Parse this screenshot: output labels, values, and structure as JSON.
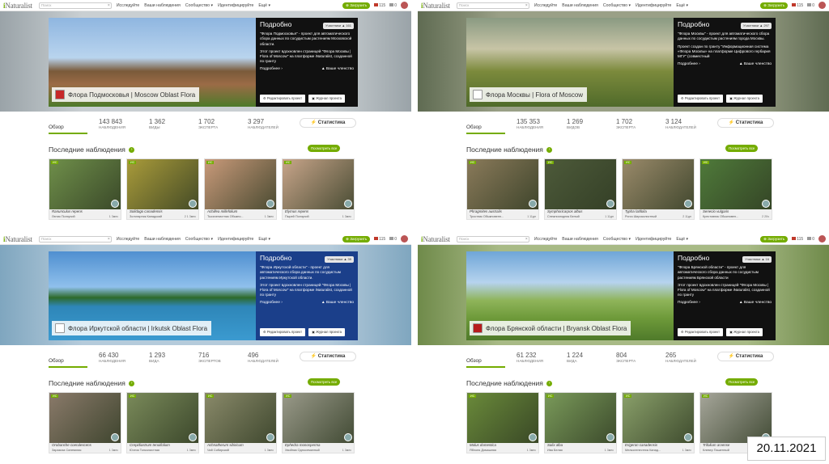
{
  "topbar": {
    "logo_prefix": "i",
    "logo_text": "Naturalist",
    "search_placeholder": "Поиск",
    "nav": [
      "Исследуйте",
      "Ваши наблюдения",
      "Сообщество ▾",
      "Идентифицируйте",
      "Ещё ▾"
    ],
    "upload": "⊕ Загрузить",
    "messages_count": "115",
    "notifications_count": "0"
  },
  "labels": {
    "about": "Подробно",
    "members": "Участники",
    "your_membership": "▲ Ваше членство",
    "details_link": "Подробнее ›",
    "edit_project": "⚙ Редактировать проект",
    "project_journal": "▣ Журнал проекта",
    "overview_tab": "Обзор",
    "stats_button": "Статистика",
    "recent_heading": "Последние наблюдения",
    "view_all": "Посмотреть все",
    "research_grade": "ИС"
  },
  "date": "20.11.2021",
  "panels": [
    {
      "title": "Флора Подмосковья | Moscow Oblast Flora",
      "members": "161",
      "desc1": "\"Флора Подмосковья\" - проект для автоматического сбора данных по сосудистым растениям Московской области.",
      "desc2": "Этот проект вдохновлен страницей \"Флора Москвы | Flora of Moscow\" на платформе iNaturalist, созданной по гранту",
      "stats": {
        "observations": "143 843",
        "observations_label": "НАБЛЮДЕНИЯ",
        "species": "1 362",
        "species_label": "ВИДЫ",
        "identifiers": "1 702",
        "identifiers_label": "ЭКСПЕРТА",
        "observers": "3 297",
        "observers_label": "НАБЛЮДАТЕЛЕЙ"
      },
      "cards": [
        {
          "sci": "Ranunculus repens",
          "common": "Лютик Ползучий",
          "meta": "1 3мес"
        },
        {
          "sci": "Solidago canadensis",
          "common": "Золотарник Канадский",
          "meta": "2 1 3мес"
        },
        {
          "sci": "Achillea millefolium",
          "common": "Тысячелистник Обыкно...",
          "meta": "1 3мес"
        },
        {
          "sci": "Elymus repens",
          "common": "Пырей Ползучий",
          "meta": "1 3мес"
        }
      ]
    },
    {
      "title": "Флора Москвы | Flora of Moscow",
      "members": "297",
      "desc1": "\"Флора Москвы\" - проект для автоматического сбора данных по сосудистым растениям города Москвы.",
      "desc2": "Проект создан по гранту \"Информационная система «Флора Москвы» на платформе Цифрового гербария МГУ\" (совместный",
      "stats": {
        "observations": "135 353",
        "observations_label": "НАБЛЮДЕНИЯ",
        "species": "1 269",
        "species_label": "ВИДОВ",
        "identifiers": "1 702",
        "identifiers_label": "ЭКСПЕРТА",
        "observers": "3 124",
        "observers_label": "НАБЛЮДАТЕЛЕЙ"
      },
      "cards": [
        {
          "sci": "Phragmites australis",
          "common": "Тростник Обыкновенн...",
          "meta": "1 11дн"
        },
        {
          "sci": "Symphoricarpos albus",
          "common": "Снежноягодник Белый",
          "meta": "1 11дн"
        },
        {
          "sci": "Typha latifolia",
          "common": "Рогоз Широколистный",
          "meta": "2 11дн"
        },
        {
          "sci": "Senecio vulgaris",
          "common": "Крестовник Обыкновен...",
          "meta": "2 20ч"
        }
      ]
    },
    {
      "title": "Флора Иркутской области | Irkutsk Oblast Flora",
      "members": "39",
      "desc1": "\"Флора Иркутской области\" - проект для автоматического сбора данных по сосудистым растениям Иркутской области.",
      "desc2": "Этот проект вдохновлен страницей \"Флора Москвы | Flora of Moscow\" на платформе iNaturalist, созданной по гранту",
      "stats": {
        "observations": "66 430",
        "observations_label": "НАБЛЮДЕНИЯ",
        "species": "1 293",
        "species_label": "ВИДА",
        "identifiers": "716",
        "identifiers_label": "ЭКСПЕРТОВ",
        "observers": "496",
        "observers_label": "НАБЛЮДАТЕЛЕЙ"
      },
      "cards": [
        {
          "sci": "Orobanche coerulescens",
          "common": "Заразиха Синеватая",
          "meta": "1 3мес"
        },
        {
          "sci": "Crepidiastrum tenuifolium",
          "common": "Ючтия Тонколистная",
          "meta": "1 3мес"
        },
        {
          "sci": "Achnatherum sibiricum",
          "common": "Чий Сибирский",
          "meta": "1 3мес"
        },
        {
          "sci": "Ephedra monosperma",
          "common": "Хвойник Односемянный",
          "meta": "1 3мес"
        }
      ]
    },
    {
      "title": "Флора Брянской области | Bryansk Oblast Flora",
      "members": "16",
      "desc1": "\"Флора Брянской области\" - проект для автоматического сбора данных по сосудистым растениям Брянской области",
      "desc2": "Этот проект вдохновлен страницей \"Флора Москвы | Flora of Moscow\" на платформе iNaturalist, созданной по гранту",
      "stats": {
        "observations": "61 232",
        "observations_label": "НАБЛЮДЕНИЯ",
        "species": "1 224",
        "species_label": "ВИДА",
        "identifiers": "804",
        "identifiers_label": "ЭКСПЕРТА",
        "observers": "265",
        "observers_label": "НАБЛЮДАТЕЛЕЙ"
      },
      "cards": [
        {
          "sci": "Malus domestica",
          "common": "Яблоня Домашняя",
          "meta": "1 3мес"
        },
        {
          "sci": "Salix alba",
          "common": "Ива Белая",
          "meta": "1 3мес"
        },
        {
          "sci": "Erigeron canadensis",
          "common": "Мелколепестник Канад...",
          "meta": "1 3мес"
        },
        {
          "sci": "Trifolium arvense",
          "common": "Клевер Пашенный",
          "meta": "1 3мес"
        }
      ]
    }
  ],
  "colors": {
    "brand_green": "#74ac00",
    "about_box": "#111111",
    "about_box_irkutsk": "#1b3f8a"
  }
}
